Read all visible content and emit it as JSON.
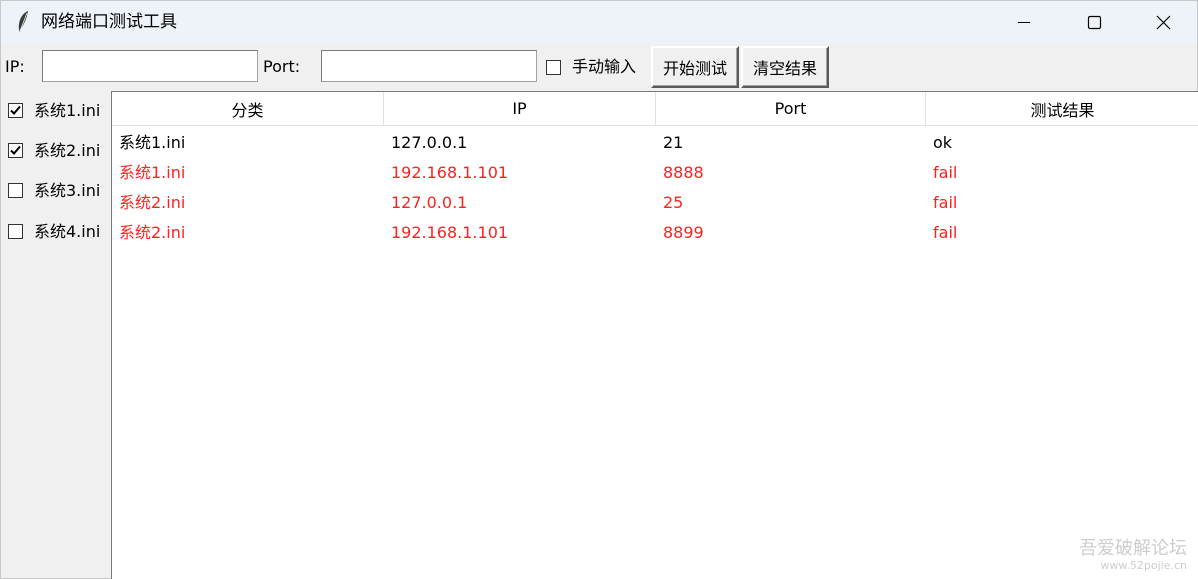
{
  "window": {
    "title": "网络端口测试工具",
    "controls": {
      "minimize": "minimize-icon",
      "maximize": "maximize-icon",
      "close": "close-icon"
    }
  },
  "toolbar": {
    "ip_label": "IP:",
    "ip_value": "",
    "port_label": "Port:",
    "port_value": "",
    "manual_label": "手动输入",
    "manual_checked": false,
    "start_label": "开始测试",
    "clear_label": "清空结果"
  },
  "sidebar": {
    "items": [
      {
        "label": "系统1.ini",
        "checked": true
      },
      {
        "label": "系统2.ini",
        "checked": true
      },
      {
        "label": "系统3.ini",
        "checked": false
      },
      {
        "label": "系统4.ini",
        "checked": false
      }
    ]
  },
  "table": {
    "columns": [
      "分类",
      "IP",
      "Port",
      "测试结果"
    ],
    "rows": [
      {
        "category": "系统1.ini",
        "ip": "127.0.0.1",
        "port": "21",
        "result": "ok",
        "status": "ok"
      },
      {
        "category": "系统1.ini",
        "ip": "192.168.1.101",
        "port": "8888",
        "result": "fail",
        "status": "fail"
      },
      {
        "category": "系统2.ini",
        "ip": "127.0.0.1",
        "port": "25",
        "result": "fail",
        "status": "fail"
      },
      {
        "category": "系统2.ini",
        "ip": "192.168.1.101",
        "port": "8899",
        "result": "fail",
        "status": "fail"
      }
    ]
  },
  "colors": {
    "fail": "#ff2020",
    "ok": "#000000"
  },
  "watermark": {
    "line1": "吾爱破解论坛",
    "line2": "www.52pojie.cn"
  }
}
